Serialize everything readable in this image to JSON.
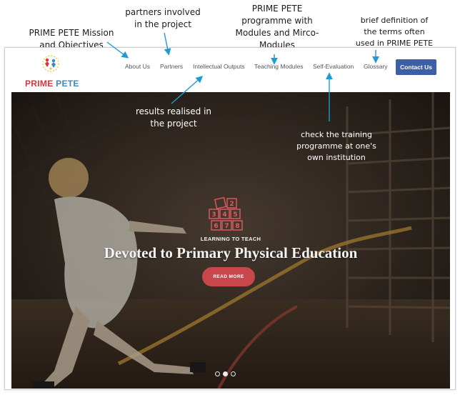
{
  "annotations": {
    "mission": [
      "PRIME PETE Mission",
      "and Objectives"
    ],
    "partners": [
      "partners involved",
      "in the project"
    ],
    "programme": [
      "PRIME PETE",
      "programme with",
      "Modules and Mirco-",
      "Modules"
    ],
    "glossary": [
      "brief definition of",
      "the terms often",
      "used in PRIME PETE"
    ],
    "results": [
      "results realised in",
      "the project"
    ],
    "training": [
      "check the training",
      "programme at one's",
      "own institution"
    ]
  },
  "site": {
    "logo": {
      "prime": "PRIME",
      "pete": "PETE",
      "icon": "star-figures-logo-icon"
    },
    "nav": [
      {
        "label": "About Us"
      },
      {
        "label": "Partners"
      },
      {
        "label": "Intellectual Outputs"
      },
      {
        "label": "Teaching Modules"
      },
      {
        "label": "Self-Evaluation"
      },
      {
        "label": "Glossary"
      }
    ],
    "contact_label": "Contact Us",
    "colors": {
      "accent": "#3d5fa6",
      "button": "#c9464a",
      "logo_red": "#e2303a",
      "logo_blue": "#3d86c6"
    }
  },
  "hero": {
    "icon": "learning-blocks-icon",
    "icon_digits": [
      "2",
      "3",
      "4",
      "5",
      "6",
      "7",
      "8"
    ],
    "tagline": "LEARNING TO TEACH",
    "headline": "Devoted to Primary Physical Education",
    "button_label": "READ MORE",
    "slides": {
      "count": 3,
      "active_index": 1
    }
  }
}
